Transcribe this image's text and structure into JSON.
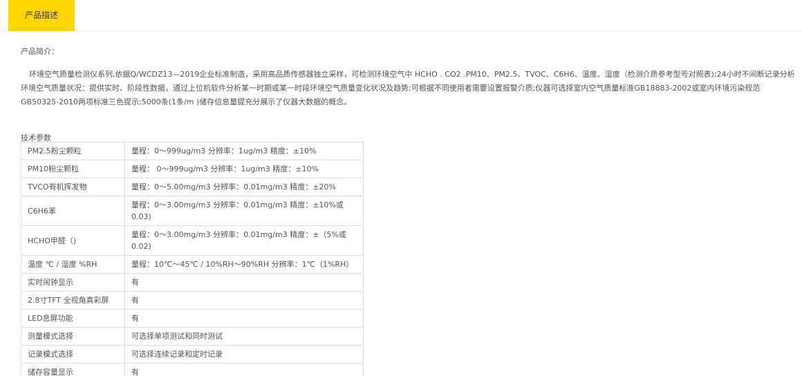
{
  "tab": {
    "label": "产品描述"
  },
  "intro": {
    "heading": "产品简介：",
    "body": "环境空气质量检测仪系列,依据Q/WCDZ13—2019企业标准制造，采用高品质传感器独立采样，可检测环境空气中 HCHO . CO2 .PM10、PM2.5、TVOC、C6H6、温度、湿度（检测介质参考型号对照表);24小时不间断记录分析环境空气质量状况：提供实时、阶段性数据，通过上位机软件分析某一时期或某一时段环境空气质量变化状况及趋势;可根据不同使用者需要设置报警介质;仪器可选择室内空气质量标准GB18883-2002或室内环境污染规范GB50325-2010两项标准三色提示;5000条(1条/m )储存信息量提充分展示了仪器大数据的概念。"
  },
  "specs": {
    "heading": "技术参数",
    "rows": [
      {
        "name": "PM2.5粉尘颗粒",
        "value": "量程：0～999ug/m3   分辨率：1ug/m3    精度：±10%"
      },
      {
        "name": "PM10粉尘颗粒",
        "value": "量程： 0～999ug/m3   分辨率：1ug/m3    精度：±10%"
      },
      {
        "name": "TVCO有机挥发物",
        "value": "量程：0～5.00mg/m3   分辨率：0.01mg/m3    精度：±20%"
      },
      {
        "name": "C6H6苯",
        "value": "量程：0～3.00mg/m3   分辨率：0.01mg/m3    精度：±10%或0.03)"
      },
      {
        "name": "HCHO甲醛（)",
        "value": "量程：0～3.00mg/m3   分辨率：0.01mg/m3    精度：±（5%或0.02)"
      },
      {
        "name": "温度 ℃ / 湿度 %RH",
        "value": "量程：10℃～45℃ / 10%RH～90%RH    分辨率：1℃（1%RH）"
      },
      {
        "name": "实时闹钟显示",
        "value": "有"
      },
      {
        "name": "2.8寸TFT 全视角真彩屏",
        "value": "有"
      },
      {
        "name": "LED息屏功能",
        "value": "有"
      },
      {
        "name": "测量模式选择",
        "value": "可选择单项测试和同时测试"
      },
      {
        "name": "记录模式选择",
        "value": "可选择连续记录和定时记录"
      },
      {
        "name": "储存容量显示",
        "value": "有"
      }
    ]
  }
}
